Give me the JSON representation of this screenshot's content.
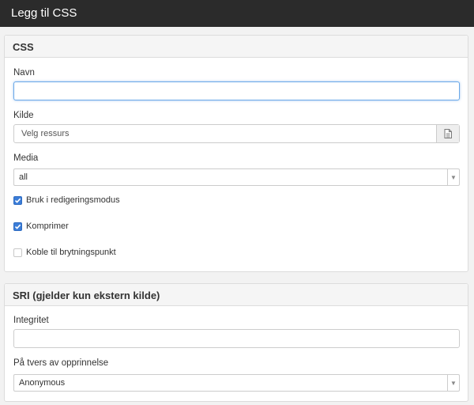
{
  "window": {
    "title": "Legg til CSS"
  },
  "css_panel": {
    "heading": "CSS",
    "name_label": "Navn",
    "name_value": "",
    "source_label": "Kilde",
    "source_value": "Velg ressurs",
    "source_button_icon": "file-icon",
    "media_label": "Media",
    "media_value": "all",
    "checkboxes": [
      {
        "label": "Bruk i redigeringsmodus",
        "checked": true
      },
      {
        "label": "Komprimer",
        "checked": true
      },
      {
        "label": "Koble til brytningspunkt",
        "checked": false
      }
    ]
  },
  "sri_panel": {
    "heading": "SRI (gjelder kun ekstern kilde)",
    "integrity_label": "Integritet",
    "integrity_value": "",
    "crossorigin_label": "På tvers av opprinnelse",
    "crossorigin_value": "Anonymous"
  },
  "colors": {
    "titlebar": "#2b2b2b",
    "checkbox_accent": "#3b7dd8",
    "focus_border": "#6aa8e8"
  }
}
